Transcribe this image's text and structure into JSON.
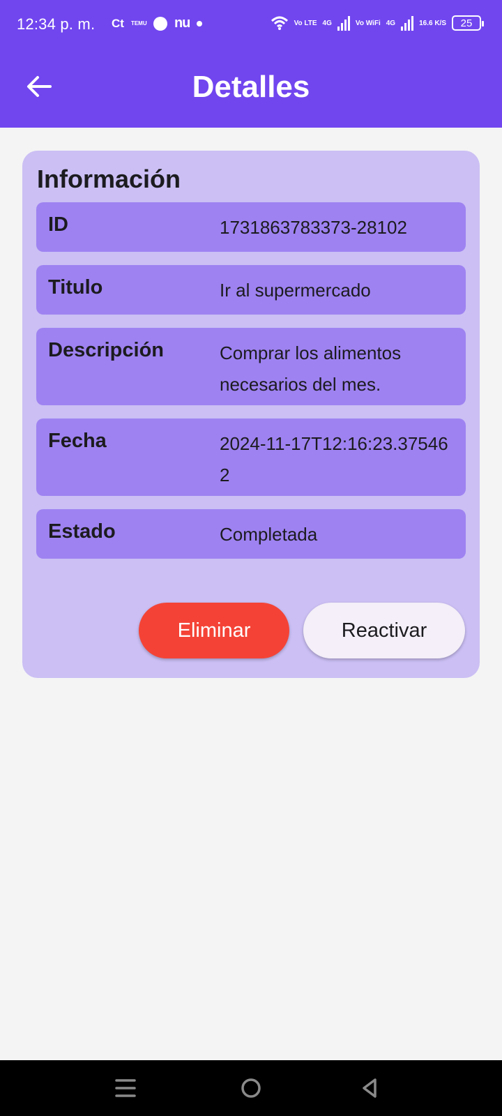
{
  "status_bar": {
    "time": "12:34 p. m.",
    "ct": "Ct",
    "temu": "TEMU",
    "nu": "nu",
    "volte1": "Vo LTE",
    "net1": "4G",
    "vowifi": "Vo WiFi",
    "net2": "4G",
    "speed": "16.6 K/S",
    "battery": "25"
  },
  "app_bar": {
    "title": "Detalles",
    "background_color": "#7146ef"
  },
  "card": {
    "title": "Información",
    "rows": [
      {
        "label": "ID",
        "value": "1731863783373-28102"
      },
      {
        "label": "Titulo",
        "value": "Ir al supermercado"
      },
      {
        "label": "Descripción",
        "value": "Comprar los alimentos necesarios del mes."
      },
      {
        "label": "Fecha",
        "value": "2024-11-17T12:16:23.375462"
      },
      {
        "label": "Estado",
        "value": "Completada"
      }
    ]
  },
  "actions": {
    "delete_label": "Eliminar",
    "reactivate_label": "Reactivar",
    "delete_color": "#f44336"
  },
  "nav_bar": {
    "icons": [
      "menu-icon",
      "home-circle-icon",
      "back-triangle-icon"
    ]
  }
}
